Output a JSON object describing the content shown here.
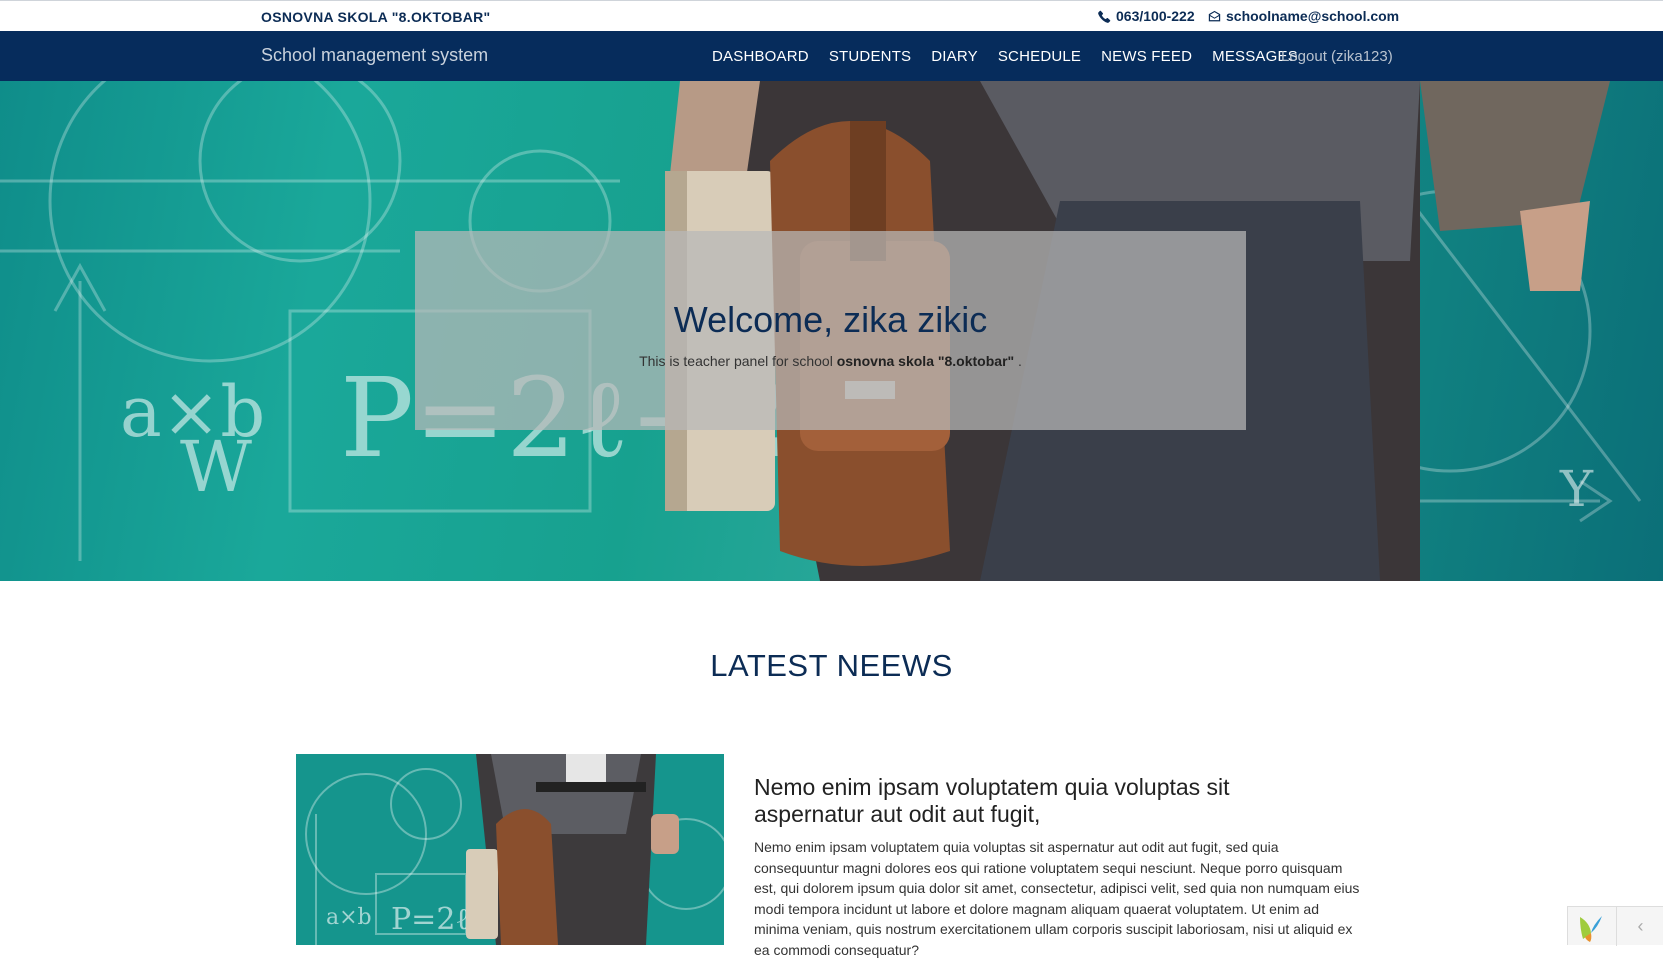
{
  "topbar": {
    "school_name": "OSNOVNA SKOLA \"8.OKTOBAR\"",
    "phone": "063/100-222",
    "email": "schoolname@school.com",
    "phone_icon": "phone-icon",
    "email_icon": "envelope-icon"
  },
  "navbar": {
    "brand": "School management system",
    "items": [
      {
        "label": "DASHBOARD"
      },
      {
        "label": "STUDENTS"
      },
      {
        "label": "DIARY"
      },
      {
        "label": "SCHEDULE"
      },
      {
        "label": "NEWS FEED"
      },
      {
        "label": "MESSAGES"
      }
    ],
    "logout": "Logout (zika123)"
  },
  "hero": {
    "title": "Welcome, zika zikic",
    "subtitle_prefix": "This is teacher panel for school ",
    "school": "osnovna skola \"8.oktobar\"",
    "subtitle_suffix": " ."
  },
  "news": {
    "heading": "LATEST NEEWS",
    "items": [
      {
        "title": "Nemo enim ipsam voluptatem quia voluptas sit aspernatur aut odit aut fugit,",
        "body": "Nemo enim ipsam voluptatem quia voluptas sit aspernatur aut odit aut fugit, sed quia consequuntur magni dolores eos qui ratione voluptatem sequi nesciunt. Neque porro quisquam est, qui dolorem ipsum quia dolor sit amet, consectetur, adipisci velit, sed quia non numquam eius modi tempora incidunt ut labore et dolore magnam aliquam quaerat voluptatem. Ut enim ad minima veniam, quis nostrum exercitationem ullam corporis suscipit laboriosam, nisi ut aliquid ex ea commodi consequatur?"
      }
    ]
  },
  "debug_toolbar": {
    "logo_icon": "yii-logo-icon",
    "toggle_icon": "chevron-left-icon",
    "toggle_glyph": "‹"
  },
  "colors": {
    "navy": "#062c5c",
    "heading": "#0c2c55",
    "teal": "#1aa89a"
  }
}
